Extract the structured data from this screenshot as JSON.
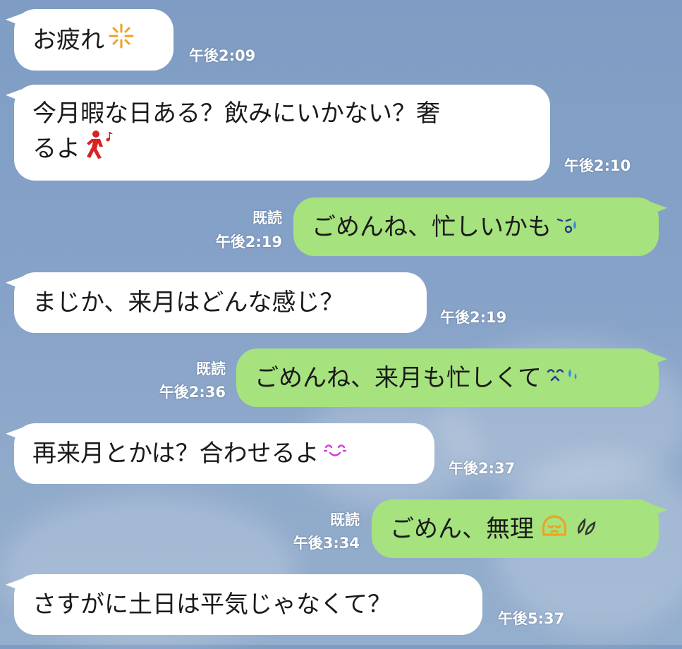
{
  "theme": {
    "incoming_bubble": "#ffffff",
    "outgoing_bubble": "#a6e27e",
    "meta_text": "#ffffff"
  },
  "messages": [
    {
      "direction": "incoming",
      "text": "お疲れ",
      "emoji": "sparkle-icon",
      "time": "午後2:09"
    },
    {
      "direction": "incoming",
      "text_line1": "今月暇な日ある？飲みにいかない？奢",
      "text_line2": "るよ",
      "emoji": "dancing-person-icon",
      "time": "午後2:10"
    },
    {
      "direction": "outgoing",
      "text": "ごめんね、忙しいかも",
      "emoji": "sweat-face-icon",
      "read": "既読",
      "time": "午後2:19"
    },
    {
      "direction": "incoming",
      "text": "まじか、来月はどんな感じ？",
      "time": "午後2:19"
    },
    {
      "direction": "outgoing",
      "text": "ごめんね、来月も忙しくて",
      "emoji": "crying-face-icon",
      "read": "既読",
      "time": "午後2:36"
    },
    {
      "direction": "incoming",
      "text": "再来月とかは？合わせるよ",
      "emoji": "smiling-face-icon",
      "time": "午後2:37"
    },
    {
      "direction": "outgoing",
      "text": "ごめん、無理",
      "emoji": "bowing-face-icon",
      "emoji2": "sweat-drops-icon",
      "read": "既読",
      "time": "午後3:34"
    },
    {
      "direction": "incoming",
      "text": "さすがに土日は平気じゃなくて？",
      "time": "午後5:37"
    }
  ]
}
